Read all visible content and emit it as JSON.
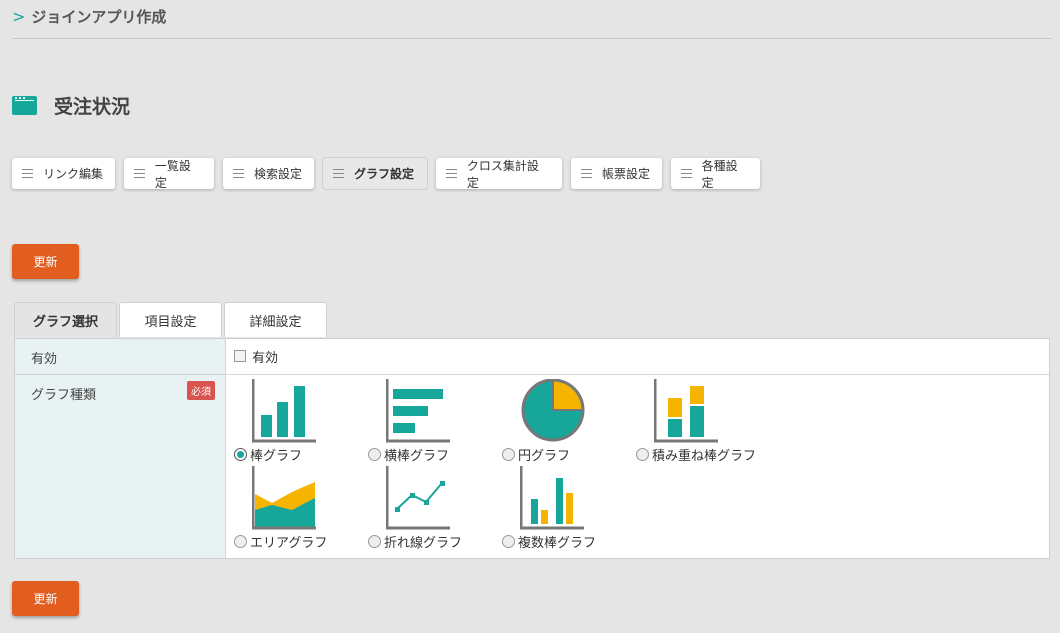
{
  "breadcrumb": {
    "title": "ジョインアプリ作成"
  },
  "page": {
    "title": "受注状況"
  },
  "nav_buttons": [
    "リンク編集",
    "一覧設定",
    "検索設定",
    "グラフ設定",
    "クロス集計設定",
    "帳票設定",
    "各種設定"
  ],
  "active_nav": "グラフ設定",
  "update_label": "更新",
  "tabs": [
    "グラフ選択",
    "項目設定",
    "詳細設定"
  ],
  "active_tab": "グラフ選択",
  "form": {
    "enabled": {
      "label": "有効",
      "checkbox_label": "有効",
      "checked": false
    },
    "chart_type": {
      "label": "グラフ種類",
      "required_badge": "必須",
      "options": [
        "棒グラフ",
        "横棒グラフ",
        "円グラフ",
        "積み重ね棒グラフ",
        "エリアグラフ",
        "折れ線グラフ",
        "複数棒グラフ"
      ],
      "selected": "棒グラフ"
    }
  },
  "colors": {
    "accent": "#17a79a",
    "highlight": "#f5b400",
    "update_button": "#e25e20",
    "required": "#d9534f"
  }
}
